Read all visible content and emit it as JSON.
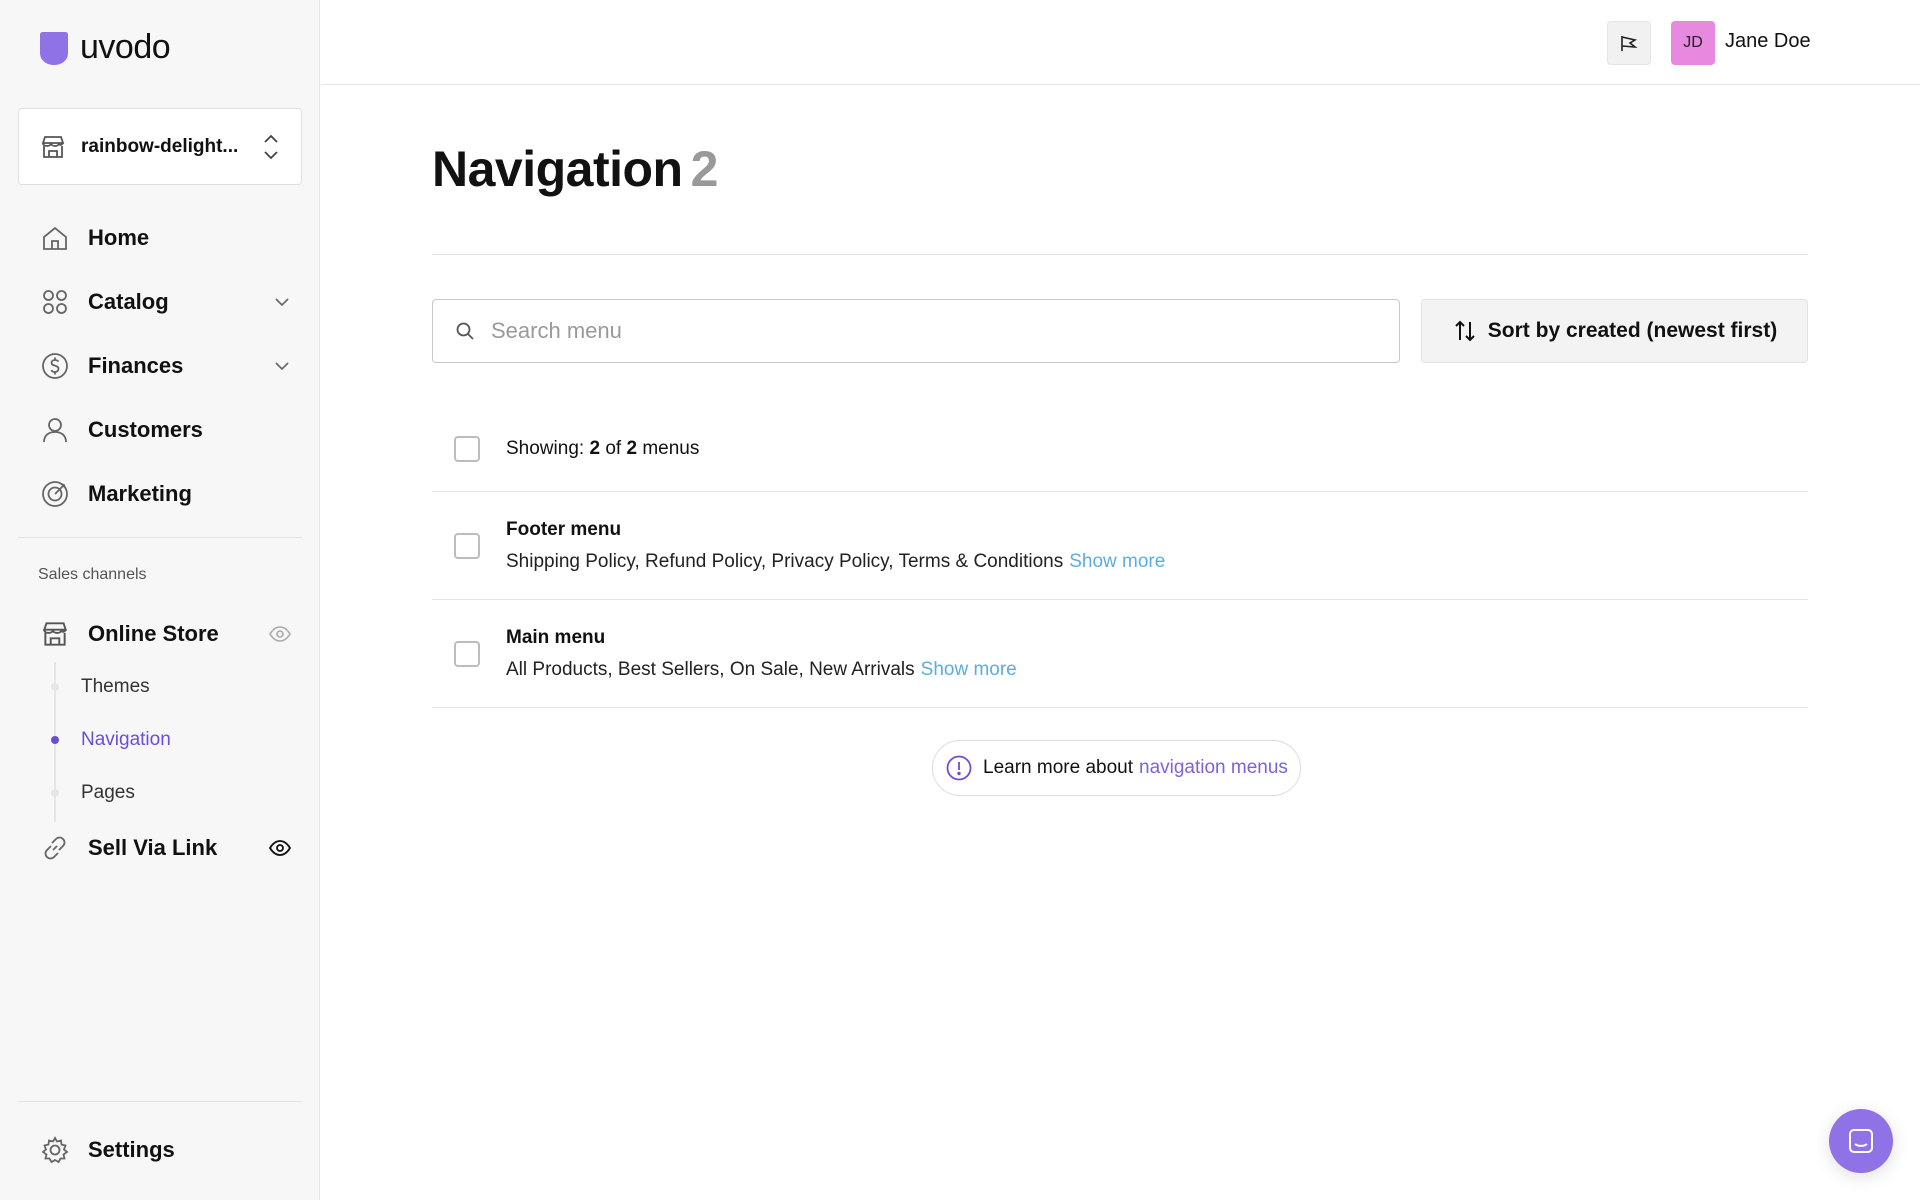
{
  "brand": {
    "name": "uvodo",
    "accent": "#6a4fd6",
    "logo_color": "#8f73e6"
  },
  "store_switcher": {
    "name": "rainbow-delight..."
  },
  "sidebar": {
    "items": [
      {
        "label": "Home",
        "icon": "home-icon"
      },
      {
        "label": "Catalog",
        "icon": "catalog-icon",
        "expandable": true
      },
      {
        "label": "Finances",
        "icon": "dollar-icon",
        "expandable": true
      },
      {
        "label": "Customers",
        "icon": "user-icon"
      },
      {
        "label": "Marketing",
        "icon": "target-icon"
      }
    ],
    "section_label": "Sales channels",
    "channels": [
      {
        "label": "Online Store",
        "icon": "store-icon",
        "visibility_icon": "eye-icon"
      },
      {
        "label": "Sell Via Link",
        "icon": "link-icon",
        "visibility_icon": "eye-icon"
      }
    ],
    "online_store_sub": [
      {
        "label": "Themes",
        "active": false
      },
      {
        "label": "Navigation",
        "active": true
      },
      {
        "label": "Pages",
        "active": false
      }
    ],
    "settings_label": "Settings"
  },
  "header": {
    "user_initials": "JD",
    "user_name": "Jane Doe",
    "avatar_color": "#e789df"
  },
  "page": {
    "title": "Navigation",
    "count": "2",
    "search_placeholder": "Search menu",
    "sort_label": "Sort by created (newest first)",
    "showing_prefix": "Showing:",
    "showing_current": "2",
    "showing_of": "of",
    "showing_total": "2",
    "showing_suffix": "menus",
    "menus": [
      {
        "name": "Footer menu",
        "items": "Shipping Policy, Refund Policy, Privacy Policy, Terms & Conditions",
        "more": "Show more"
      },
      {
        "name": "Main menu",
        "items": "All Products, Best Sellers, On Sale, New Arrivals",
        "more": "Show more"
      }
    ],
    "learn_prefix": "Learn more about",
    "learn_link": "navigation menus"
  }
}
